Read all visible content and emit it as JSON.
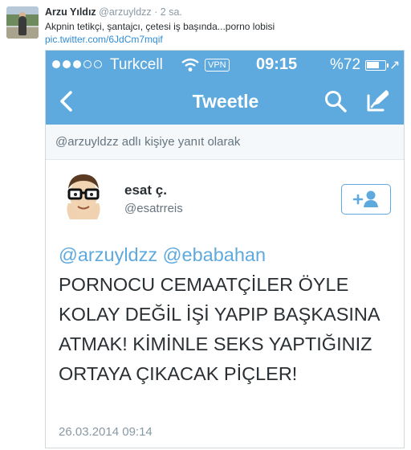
{
  "outer_tweet": {
    "name": "Arzu Yıldız",
    "handle": "@arzuyldzz",
    "separator": "·",
    "time": "2 sa.",
    "text": "Akpnin tetikçi, şantajcı, çetesi iş başında...porno lobisi",
    "link": "pic.twitter.com/6JdCm7mqif"
  },
  "screenshot": {
    "status_bar": {
      "carrier": "Turkcell",
      "vpn": "VPN",
      "time": "09:15",
      "battery_percent": "%72",
      "battery_level": 0.72,
      "signal_dots_filled": 3,
      "signal_dots_total": 5
    },
    "nav": {
      "title": "Tweetle",
      "back_icon": "chevron-left-icon",
      "search_icon": "search-icon",
      "compose_icon": "compose-icon"
    },
    "reply_context": "@arzuyldzz adlı kişiye yanıt olarak",
    "author": {
      "name": "esat ç.",
      "handle": "@esatrreis",
      "follow_icon": "add-user-icon"
    },
    "tweet": {
      "mention1": "@arzuyldzz",
      "mention2": "@ebabahan",
      "body": "PORNOCU CEMAATÇİLER ÖYLE KOLAY DEĞİL İŞİ YAPIP BAŞKASINA ATMAK! KİMİNLE SEKS YAPTIĞINIZ ORTAYA ÇIKACAK PİÇLER!",
      "date": "26.03.2014 09:14"
    },
    "colors": {
      "accent": "#5ea9dd",
      "reply_bg": "#f5f8fa",
      "link": "#2f8bd2"
    }
  }
}
